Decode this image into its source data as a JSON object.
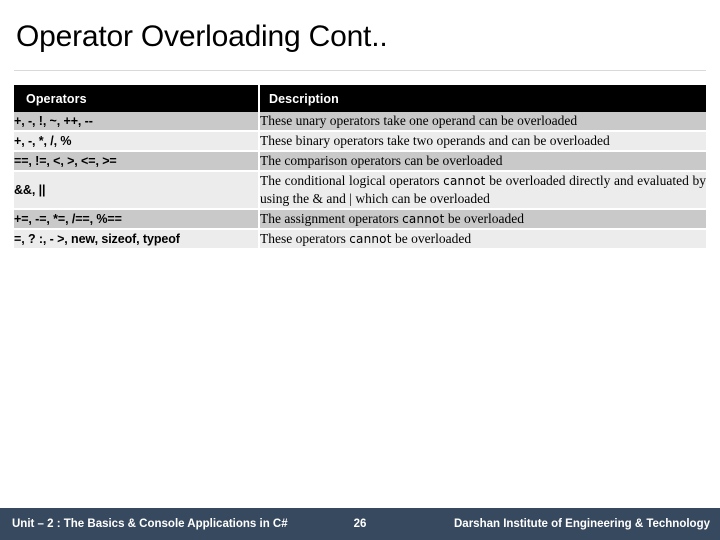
{
  "slide": {
    "title": "Operator Overloading Cont..",
    "colors": {
      "header_bg": "#000000",
      "header_text": "#ffffff",
      "row_dark": "#c9c9c9",
      "row_light": "#ececec",
      "footer_bg": "#37495e",
      "footer_text": "#ffffff",
      "title_rule": "#d9d9d9"
    }
  },
  "table": {
    "columns": [
      "Operators",
      "Description"
    ],
    "rows": [
      {
        "operators": "+, -, !, ~, ++, --",
        "description_parts": [
          {
            "text": "These unary operators take one operand can be overloaded",
            "style": "normal"
          }
        ]
      },
      {
        "operators": "+, -, *, /, %",
        "description_parts": [
          {
            "text": "These binary operators take two operands and can be overloaded",
            "style": "normal"
          }
        ]
      },
      {
        "operators": "==, !=, <, >, <=, >=",
        "description_parts": [
          {
            "text": "The comparison operators can be overloaded",
            "style": "normal"
          }
        ]
      },
      {
        "operators": "&&, ||",
        "description_parts": [
          {
            "text": "The conditional logical operators ",
            "style": "normal"
          },
          {
            "text": "cannot",
            "style": "wide"
          },
          {
            "text": " be overloaded directly and evaluated by using the & and | which can be overloaded",
            "style": "normal"
          }
        ]
      },
      {
        "operators": "+=, -=, *=, /==, %==",
        "description_parts": [
          {
            "text": "The assignment operators ",
            "style": "normal"
          },
          {
            "text": "cannot",
            "style": "wide"
          },
          {
            "text": " be overloaded",
            "style": "normal"
          }
        ]
      },
      {
        "operators": "=, ? :, - >, new, sizeof, typeof",
        "description_parts": [
          {
            "text": "These operators ",
            "style": "normal"
          },
          {
            "text": "cannot",
            "style": "wide"
          },
          {
            "text": " be overloaded",
            "style": "normal"
          }
        ]
      }
    ]
  },
  "footer": {
    "left": "Unit – 2 : The Basics & Console Applications in C#",
    "page_number": "26",
    "right": "Darshan Institute of Engineering & Technology"
  }
}
